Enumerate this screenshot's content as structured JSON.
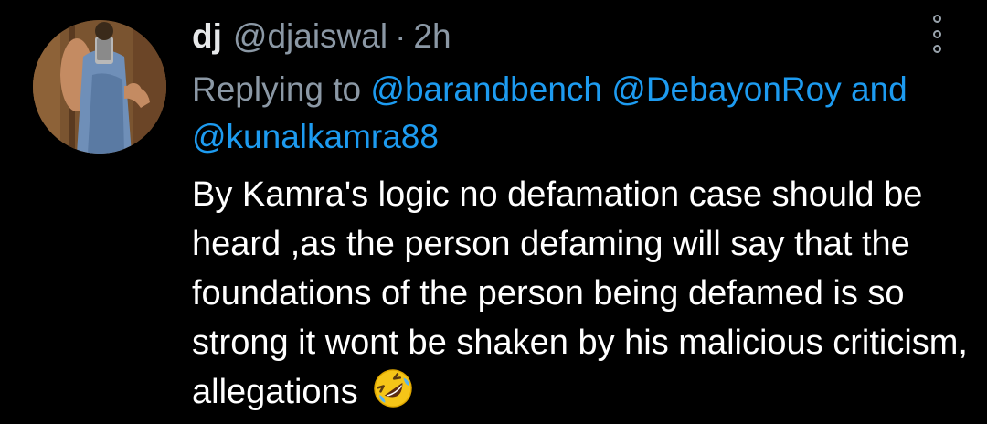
{
  "tweet": {
    "display_name": "dj",
    "handle": "@djaiswal",
    "separator": "·",
    "time": "2h",
    "replying_prefix": "Replying to",
    "mentions": [
      "@barandbench",
      "@DebayonRoy",
      "@kunalkamra88"
    ],
    "mention_joiner": "and",
    "text": "By Kamra's logic no defamation case should be heard ,as the person defaming will say that the foundations of the person being defamed is so strong it wont be shaken by his malicious criticism, allegations",
    "emoji_icon": "rolling-on-floor-laughing-icon",
    "more_icon": "more-options-icon"
  },
  "colors": {
    "background": "#000000",
    "secondary_text": "#8b98a5",
    "mention": "#1d9bf0",
    "primary_text": "#ffffff"
  }
}
